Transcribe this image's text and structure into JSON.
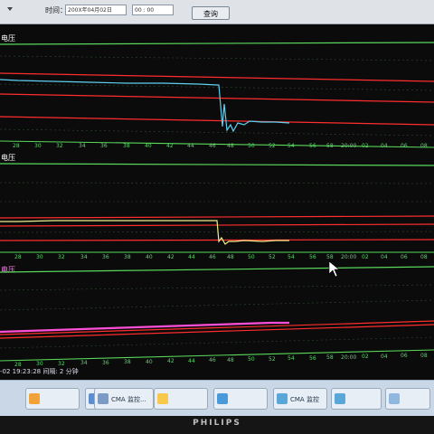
{
  "toolbar": {
    "time_label": "时间：",
    "date_value": "200X年04月02日",
    "time_value": "00 : 00",
    "query_button": "查询"
  },
  "panels": [
    {
      "title": "电压",
      "ticks": [
        "28",
        "30",
        "32",
        "34",
        "36",
        "38",
        "40",
        "42",
        "44",
        "46",
        "48",
        "50",
        "52",
        "54",
        "56",
        "58",
        "20:00",
        "02",
        "04",
        "06",
        "08"
      ]
    },
    {
      "title": "电压",
      "ticks": [
        "28",
        "30",
        "32",
        "34",
        "36",
        "38",
        "40",
        "42",
        "44",
        "46",
        "48",
        "50",
        "52",
        "54",
        "56",
        "58",
        "20:00",
        "02",
        "04",
        "06",
        "08"
      ]
    },
    {
      "title": "电压",
      "ticks": [
        "28",
        "30",
        "32",
        "34",
        "36",
        "38",
        "40",
        "42",
        "44",
        "46",
        "48",
        "50",
        "52",
        "54",
        "56",
        "58",
        "20:00",
        "02",
        "04",
        "06",
        "08"
      ]
    }
  ],
  "chart_data": [
    {
      "type": "line",
      "x": [
        "28",
        "30",
        "32",
        "34",
        "36",
        "38",
        "40",
        "42",
        "44",
        "46",
        "48",
        "50",
        "52",
        "54"
      ],
      "series": [
        {
          "values": [
            0.12,
            0.13,
            0.14,
            0.14,
            0.14,
            0.14,
            0.14,
            0.14,
            0.15,
            0.15,
            0.85,
            0.62,
            0.63,
            0.63
          ]
        }
      ],
      "color": "#5fd0f0"
    },
    {
      "type": "line",
      "x": [
        "28",
        "30",
        "32",
        "34",
        "36",
        "38",
        "40",
        "42",
        "44",
        "46",
        "48",
        "50",
        "52",
        "54"
      ],
      "series": [
        {
          "values": [
            0.26,
            0.27,
            0.27,
            0.27,
            0.27,
            0.27,
            0.27,
            0.27,
            0.28,
            0.28,
            0.78,
            0.76,
            0.76,
            0.75
          ]
        }
      ],
      "color": "#f1f08c"
    },
    {
      "type": "line",
      "x": [
        "28",
        "30",
        "32",
        "34",
        "36",
        "38",
        "40",
        "42",
        "44",
        "46",
        "48",
        "50",
        "52",
        "54"
      ],
      "series": [
        {
          "values": [
            0.5,
            0.49,
            0.49,
            0.48,
            0.48,
            0.47,
            0.47,
            0.46,
            0.46,
            0.45,
            0.45,
            0.44,
            0.44,
            0.44
          ]
        }
      ],
      "color": "#ff4fd8"
    }
  ],
  "statusbar": {
    "text": "-02 19:23:28  间隔: 2 分钟"
  },
  "taskbar": {
    "items": [
      {
        "label": "",
        "icon": "app-icon"
      },
      {
        "label": "",
        "icon": "browser-icon"
      },
      {
        "label": "CMA 监控...",
        "icon": "chart-icon"
      },
      {
        "label": "",
        "icon": "photo-icon"
      },
      {
        "label": "",
        "icon": "window-icon"
      },
      {
        "label": "CMA 监控",
        "icon": "network-icon"
      },
      {
        "label": "",
        "icon": "network-icon"
      },
      {
        "label": "",
        "icon": "folder-icon"
      }
    ]
  },
  "monitor": {
    "brand": "PHILIPS"
  }
}
